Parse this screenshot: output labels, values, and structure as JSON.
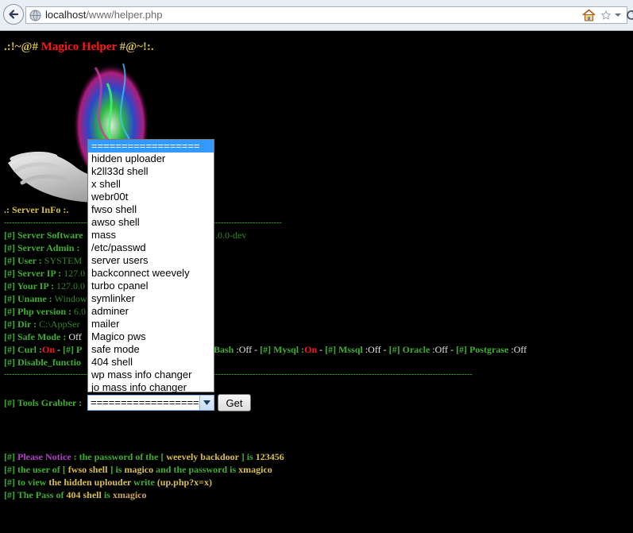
{
  "browser": {
    "url_host": "localhost",
    "url_path": "/www/helper.php"
  },
  "title": {
    "prefix": ".:!~@#",
    "name": "Magico Helper",
    "suffix": "#@~!:."
  },
  "server_info": {
    "heading": ".: Server InFo :.",
    "dashes": "-----------------------------------------------------------------------------------------------------------------------------------------------------",
    "dashes2": "--------------------------------------------------------------------------------------------------------------------------------------------------------------------------------------------------------------------------------------------",
    "rows": {
      "software": {
        "tag": "[#]",
        "label": "Server Software",
        "value": ".0.0-dev"
      },
      "admin": {
        "tag": "[#]",
        "label": "Server Admin :"
      },
      "user": {
        "tag": "[#]",
        "label": "User :",
        "value": "SYSTEM"
      },
      "ip": {
        "tag": "[#]",
        "label": "Server IP :",
        "value": "127.0"
      },
      "your_ip": {
        "tag": "[#]",
        "label": "Your IP :",
        "value": "127.0.0"
      },
      "uname": {
        "tag": "[#]",
        "label": "Uname :",
        "value": "Window"
      },
      "php": {
        "tag": "[#]",
        "label": "Php version :",
        "value": "6.0"
      },
      "dir": {
        "tag": "[#]",
        "label": "Dir :",
        "value": "C:\\AppSer"
      },
      "safe": {
        "tag": "[#]",
        "label": "Safe Mode :",
        "value": "Off"
      },
      "disable": {
        "tag": "[#]",
        "label": "Disable_functio"
      }
    },
    "curl_line": {
      "tag": "[#]",
      "curl_label": "Curl :",
      "curl_val": "On",
      "sep1": " - ",
      "tag2": "[#]",
      "p": "P",
      "bash_label": "Bash",
      "bash_val": ":Off",
      "sep2": " - ",
      "tag3": "[#]",
      "mysql_label": "Mysql :",
      "mysql_val": "On",
      "sep3": " - ",
      "tag4": "[#]",
      "mssql_label": "Mssql",
      "mssql_val": ":Off",
      "sep4": " - ",
      "tag5": "[#]",
      "oracle_label": "Oracle",
      "oracle_val": ":Off",
      "sep5": " - ",
      "tag6": "[#]",
      "pg_label": "Postgrase",
      "pg_val": ":Off"
    }
  },
  "tools": {
    "tag": "[#]",
    "label": "Tools Grabber :",
    "selected": "==================",
    "get_label": "Get",
    "options": [
      "==================",
      "hidden uploader",
      "k2ll33d shell",
      "x shell",
      "webr00t",
      "fwso shell",
      "awso shell",
      "mass",
      "/etc/passwd",
      "server users",
      "backconnect weevely",
      "turbo cpanel",
      "symlinker",
      "adminer",
      "mailer",
      "Magico pws",
      "safe mode",
      "404 shell",
      "wp mass info changer",
      "jo mass info changer"
    ]
  },
  "notices": {
    "n1": {
      "tag": "[#]",
      "a": "Please Notice",
      "b": ": the password of the",
      "c": "[",
      "d": "weevely backdoor",
      "e": "] is",
      "f": "123456"
    },
    "n2": {
      "tag": "[#]",
      "a": "the user of [",
      "b": "fwso shell",
      "c": "] is",
      "d": "magico",
      "e": "and the password is",
      "f": "xmagico"
    },
    "n3": {
      "tag": "[#]",
      "a": "to view",
      "b": "the hidden uplouder",
      "c": "write",
      "d": "(up.php?x=x)"
    },
    "n4": {
      "tag": "[#]",
      "a": "The Pass of",
      "b": "404 shell",
      "c": "is",
      "d": "xmagico"
    }
  },
  "colors": {
    "green": "#3fae30",
    "red": "#ff1515",
    "gold": "#d8bf4a",
    "highlight": "#3399ff"
  }
}
